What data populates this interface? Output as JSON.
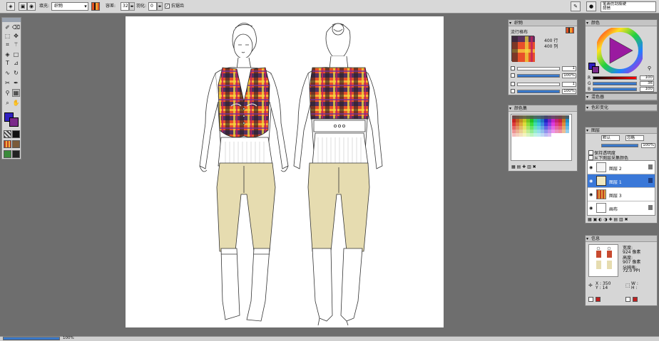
{
  "toolbar": {
    "fill_label": "填充:",
    "fill_value": "织物",
    "capacity_label": "容差:",
    "capacity_value": "32",
    "feather_label": "羽化:",
    "feather_value": "0",
    "antialias_label": "抗锯齿",
    "brush_preset_line1": "笔画仿刮痕硬",
    "brush_preset_line2": "琵琶"
  },
  "fabric_panel": {
    "title": "织物",
    "name": "流行格布",
    "width": "400 行",
    "height": "400 列",
    "rows": [
      {
        "value": "1"
      },
      {
        "value": "100%"
      },
      {
        "value": "1"
      },
      {
        "value": "100%"
      }
    ]
  },
  "color_panel": {
    "title": "颜色",
    "r_label": "R",
    "r_value": "100",
    "g_label": "G",
    "g_value": "36",
    "b_label": "B",
    "b_value": "100",
    "foreground": "#3020c0",
    "background": "#7a2a8a"
  },
  "swatch_panel": {
    "title": "颜色集"
  },
  "mixer_header": {
    "title": "混色器"
  },
  "gradient_header": {
    "title": "色彩变化"
  },
  "layers_panel": {
    "title": "图层",
    "blend_mode": "默认",
    "composite": "忽略",
    "opacity": "100%",
    "preserve_transparency": "保持透明度",
    "pick_from_layer": "从下图层采集颜色",
    "layers": [
      {
        "name": "图层 2",
        "selected": false
      },
      {
        "name": "图层 1",
        "selected": true
      },
      {
        "name": "图层 3",
        "selected": false
      },
      {
        "name": "画布",
        "selected": false
      }
    ]
  },
  "info_panel": {
    "title": "信息",
    "width_label": "宽度:",
    "width_value": "924 像素",
    "height_label": "高度:",
    "height_value": "907 像素",
    "res_label": "分辨率:",
    "res_value": "72.0 PPI",
    "x_label": "X : 350",
    "y_label": "Y : 14",
    "w_label": "W :",
    "h_label": "H :"
  },
  "status": {
    "zoom": "100%"
  }
}
